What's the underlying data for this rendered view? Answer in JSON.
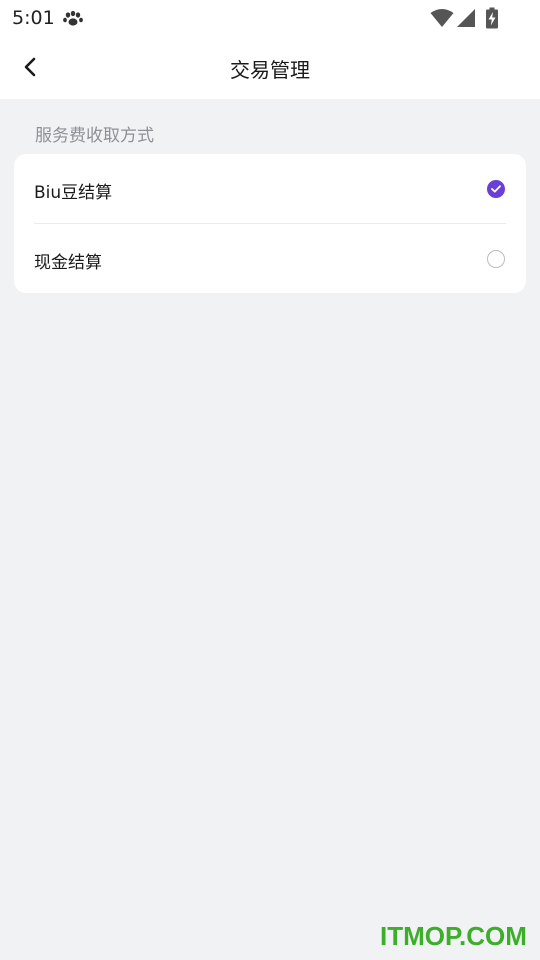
{
  "status_bar": {
    "time": "5:01",
    "icons": [
      "paw-icon",
      "wifi-icon",
      "signal-icon",
      "battery-charging-icon"
    ]
  },
  "header": {
    "title": "交易管理",
    "back_icon": "chevron-left-icon"
  },
  "section": {
    "title": "服务费收取方式"
  },
  "options": [
    {
      "label": "Biu豆结算",
      "selected": true
    },
    {
      "label": "现金结算",
      "selected": false
    }
  ],
  "colors": {
    "accent": "#6a3fd8",
    "background": "#f1f2f4",
    "card": "#ffffff",
    "secondary_text": "#8e9097",
    "watermark": "#3cae2a"
  },
  "watermark": {
    "text": "ITMOP.COM"
  }
}
